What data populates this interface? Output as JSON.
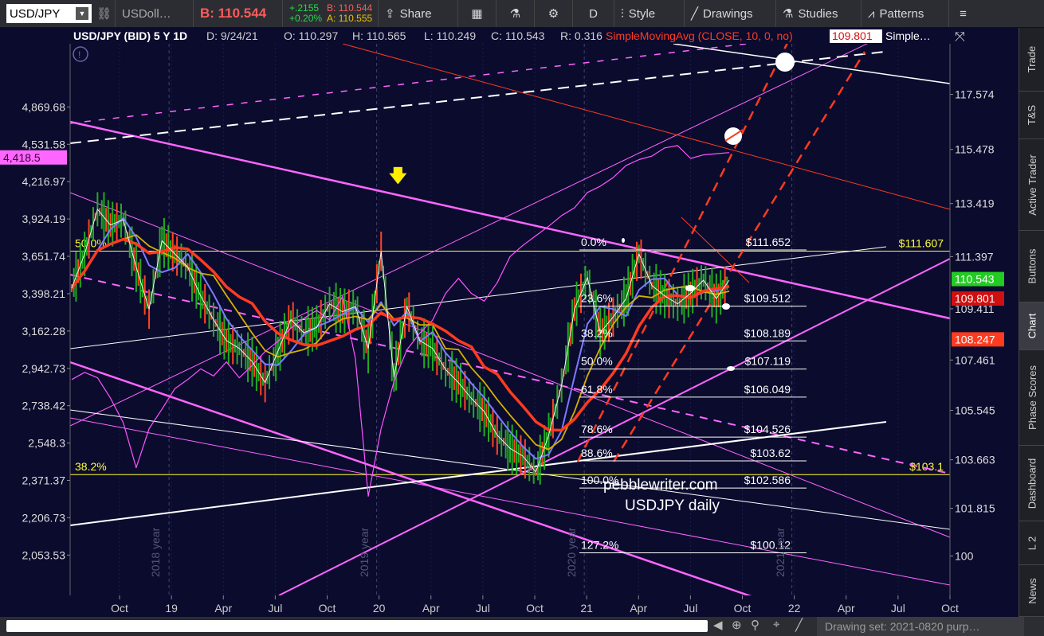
{
  "toolbar": {
    "symbol": "USD/JPY",
    "compare": "USDoll…",
    "bid_label": "B: 110.544",
    "change": "+.2155",
    "change_pct": "+0.20%",
    "quote_b": "B: 110.544",
    "quote_a": "A: 110.555",
    "share": "Share",
    "period": "D",
    "style": "Style",
    "drawings": "Drawings",
    "studies": "Studies",
    "patterns": "Patterns"
  },
  "header": {
    "instrument": "USD/JPY (BID) 5 Y 1D",
    "date": "D: 9/24/21",
    "open": "O: 110.297",
    "high": "H: 110.565",
    "low": "L: 110.249",
    "close": "C: 110.543",
    "range": "R: 0.316",
    "study": "SimpleMovingAvg (CLOSE, 10, 0, no)",
    "study_value": "109.801",
    "study2": "Simple…"
  },
  "colors": {
    "background": "#0b0b2e",
    "spx": "#ff55ff",
    "sma_red": "#ff3b1f",
    "sma_blue": "#7b7bff",
    "sma_gold": "#d4b000",
    "fib": "#ffffff",
    "yellow": "#ffff33",
    "up_bar": "#22aa22",
    "down_bar": "#ff4422"
  },
  "chart_data": {
    "type": "line",
    "title": "USD/JPY (BID) 5 Y 1D",
    "annotation_lines": [
      "pebblewriter.com",
      "USDJPY daily"
    ],
    "x_ticks": [
      "Oct",
      "19",
      "Apr",
      "Jul",
      "Oct",
      "20",
      "Apr",
      "Jul",
      "Oct",
      "21",
      "Apr",
      "Jul",
      "Oct",
      "22",
      "Apr",
      "Jul",
      "Oct"
    ],
    "year_markers": [
      "2018 year",
      "2019 year",
      "2020 year",
      "2021 year"
    ],
    "right_axis_ticks": [
      117.574,
      115.478,
      113.419,
      111.397,
      109.411,
      107.461,
      105.545,
      103.663,
      101.815,
      100
    ],
    "left_axis_ticks": [
      "4,869.68",
      "4,531.58",
      "4,216.97",
      "3,924.19",
      "3,651.74",
      "3,398.21",
      "3,162.28",
      "2,942.73",
      "2,738.42",
      "2,548.3",
      "2,371.37",
      "2,206.73",
      "2,053.53"
    ],
    "right_ylim": [
      98.5,
      119.5
    ],
    "left_scale": "log",
    "price_tags": [
      {
        "label": "110.543",
        "color": "#22cc22"
      },
      {
        "label": "109.801",
        "color": "#d01010"
      },
      {
        "label": "108.247",
        "color": "#ff3b1f"
      }
    ],
    "left_tag": {
      "label": "4,418.5",
      "color": "#ff66ff"
    },
    "fibonacci": [
      {
        "level": "0.0%",
        "price": "$111.652"
      },
      {
        "level": "23.6%",
        "price": "$109.512"
      },
      {
        "level": "38.2%",
        "price": "$108.189"
      },
      {
        "level": "50.0%",
        "price": "$107.119"
      },
      {
        "level": "61.8%",
        "price": "$106.049"
      },
      {
        "level": "78.6%",
        "price": "$104.526"
      },
      {
        "level": "88.6%",
        "price": "$103.62"
      },
      {
        "level": "100.0%",
        "price": "$102.586"
      },
      {
        "level": "127.2%",
        "price": "$100.12"
      }
    ],
    "horizontal_levels": [
      {
        "label_left": "50.0%",
        "label_right": "$111.607",
        "value": 111.607
      },
      {
        "label_left": "38.2%",
        "label_right": "$103.1",
        "value": 103.1
      }
    ],
    "series": [
      {
        "name": "USD/JPY",
        "values": [
          110.2,
          111.5,
          113.2,
          112.6,
          112.8,
          111.0,
          109.4,
          112.0,
          111.5,
          111.0,
          109.9,
          109.0,
          108.2,
          107.9,
          107.4,
          106.6,
          107.8,
          109.0,
          108.5,
          108.7,
          109.6,
          109.3,
          109.5,
          107.9,
          111.6,
          106.8,
          109.5,
          108.2,
          107.9,
          107.1,
          106.6,
          106.0,
          105.5,
          104.6,
          104.1,
          103.8,
          103.2,
          104.6,
          106.5,
          109.4,
          110.6,
          108.5,
          109.1,
          109.8,
          111.5,
          110.3,
          109.9,
          109.6,
          110.0,
          110.5,
          109.8,
          110.5
        ]
      },
      {
        "name": "S&P 500",
        "values": [
          2880,
          2920,
          2890,
          2780,
          2650,
          2430,
          2620,
          2720,
          2830,
          2880,
          2940,
          2900,
          2980,
          2890,
          2960,
          3040,
          3100,
          3180,
          3240,
          3290,
          3230,
          3380,
          3000,
          2300,
          2620,
          2870,
          3050,
          3150,
          3230,
          3400,
          3500,
          3400,
          3350,
          3470,
          3650,
          3730,
          3800,
          3870,
          3950,
          4010,
          4130,
          4180,
          4250,
          4350,
          4400,
          4430,
          4500,
          4520,
          4410,
          4440,
          4450,
          4460
        ]
      }
    ]
  },
  "right_tabs": [
    "Trade",
    "T&S",
    "Active Trader",
    "Buttons",
    "Chart",
    "Phase Scores",
    "Dashboard",
    "L 2",
    "News"
  ],
  "bottom": {
    "drawing_set": "Drawing set: 2021-0820 purp…"
  }
}
